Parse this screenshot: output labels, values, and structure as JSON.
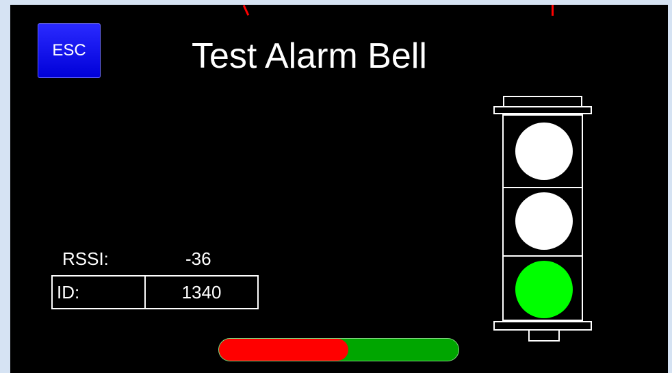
{
  "header": {
    "esc_label": "ESC",
    "title": "Test Alarm Bell"
  },
  "signal": {
    "rssi_label": "RSSI:",
    "rssi_value": "-36"
  },
  "device": {
    "id_label": "ID:",
    "id_value": "1340"
  },
  "progress": {
    "percent": 54,
    "fill_color": "#ff0000",
    "track_color": "#00a600"
  },
  "traffic_light": {
    "lamps": [
      {
        "state": "off",
        "color": "#ffffff"
      },
      {
        "state": "off",
        "color": "#ffffff"
      },
      {
        "state": "on",
        "color": "#00ff00"
      }
    ]
  },
  "colors": {
    "screen_background": "#000000",
    "frame_background": "#d6e3f3",
    "esc_button": "#0000e0",
    "annotation_marks": "#ff0000"
  }
}
